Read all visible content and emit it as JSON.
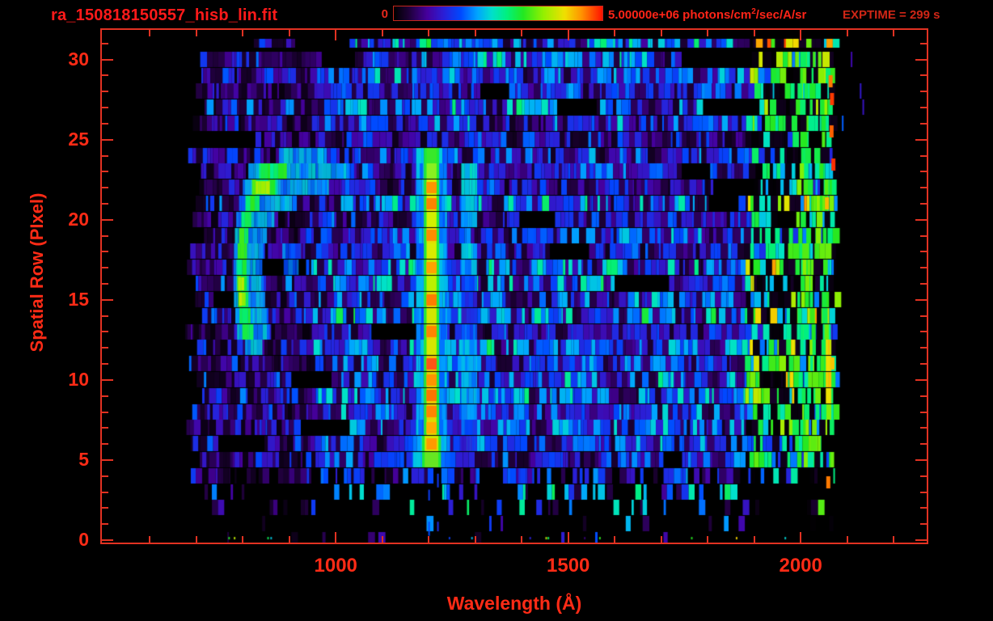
{
  "header": {
    "title": "ra_150818150557_hisb_lin.fit",
    "exptime": "EXPTIME = 299 s",
    "colorbar": {
      "min_label": "0",
      "max_prefix": "5.00000e+06 photons/cm",
      "max_sup": "2",
      "max_suffix": "/sec/A/sr"
    }
  },
  "chart_data": {
    "type": "heatmap",
    "title": "ra_150818150557_hisb_lin.fit",
    "xlabel": "Wavelength (Å)",
    "ylabel": "Spatial Row (PIxel)",
    "xlim": [
      497,
      2271
    ],
    "ylim": [
      -0.15,
      31.85
    ],
    "grid": false,
    "frame_color": "#e23222",
    "label_color": "#ff2b16",
    "xticks": [
      {
        "value": 1000,
        "label": "1000"
      },
      {
        "value": 1500,
        "label": "1500"
      },
      {
        "value": 2000,
        "label": "2000"
      }
    ],
    "xtick_minor": {
      "from": 600,
      "to": 2200,
      "step": 100
    },
    "yticks": [
      {
        "value": 0,
        "label": "0"
      },
      {
        "value": 5,
        "label": "5"
      },
      {
        "value": 10,
        "label": "10"
      },
      {
        "value": 15,
        "label": "15"
      },
      {
        "value": 20,
        "label": "20"
      },
      {
        "value": 25,
        "label": "25"
      },
      {
        "value": 30,
        "label": "30"
      }
    ],
    "ytick_minor": {
      "from": 0,
      "to": 31,
      "step": 1
    },
    "colorbar": {
      "min": 0,
      "max": 5000000,
      "units": "photons/cm2/sec/A/sr"
    },
    "exposure_seconds": 299,
    "colormap_stops": [
      [
        0.0,
        "#000000"
      ],
      [
        0.07,
        "#1e0038"
      ],
      [
        0.16,
        "#46009e"
      ],
      [
        0.24,
        "#2a20d8"
      ],
      [
        0.32,
        "#0048ff"
      ],
      [
        0.4,
        "#00a4ff"
      ],
      [
        0.47,
        "#00e0cc"
      ],
      [
        0.54,
        "#00f080"
      ],
      [
        0.62,
        "#22e822"
      ],
      [
        0.72,
        "#96f000"
      ],
      [
        0.82,
        "#f0e000"
      ],
      [
        0.9,
        "#ff9400"
      ],
      [
        1.0,
        "#ff1400"
      ]
    ],
    "noise": {
      "row_range": [
        0,
        31
      ],
      "data_wavelength": [
        675,
        2066
      ],
      "sparse_row_density": [
        0.05,
        0.07,
        0.15,
        0.32,
        0.6
      ],
      "regions": [
        {
          "until": 950,
          "weights": [
            [
              0.5,
              0.02,
              0.11
            ],
            [
              0.86,
              0.12,
              0.26
            ],
            [
              1.0,
              0.26,
              0.36
            ]
          ]
        },
        {
          "until": 1880,
          "weights": [
            [
              0.28,
              0.04,
              0.14
            ],
            [
              0.76,
              0.16,
              0.36
            ],
            [
              0.95,
              0.34,
              0.44
            ],
            [
              1.0,
              0.42,
              0.5
            ]
          ]
        },
        {
          "until": 2066,
          "weights": [
            [
              0.4,
              0.0,
              0.05
            ],
            [
              0.58,
              0.28,
              0.42
            ],
            [
              0.92,
              0.5,
              0.7
            ],
            [
              1.0,
              0.68,
              0.8
            ]
          ]
        }
      ]
    },
    "features": {
      "arc": {
        "label": "curved-emission-feature",
        "rows": [
          {
            "r": 24,
            "cyan": [
              878,
              970
            ]
          },
          {
            "r": 23,
            "green": [
              835,
              895
            ],
            "cyan": [
              812,
              1030
            ]
          },
          {
            "r": 22,
            "green": [
              820,
              872
            ],
            "cyan": [
              800,
              985
            ],
            "core2": [
              828,
              858
            ]
          },
          {
            "r": 21,
            "green": [
              806,
              836
            ],
            "cyan": [
              792,
              906
            ]
          },
          {
            "r": 20,
            "green": [
              797,
              818
            ],
            "cyan": [
              786,
              868
            ]
          },
          {
            "r": 19,
            "green": [
              792,
              812
            ],
            "cyan": [
              783,
              852
            ]
          },
          {
            "r": 18,
            "green": [
              789,
              809
            ],
            "cyan": [
              781,
              846
            ],
            "cyan2": [
              885,
              925
            ]
          },
          {
            "r": 17,
            "green": [
              788,
              808
            ],
            "cyan": [
              780,
              842
            ],
            "cyan2": [
              888,
              920
            ]
          },
          {
            "r": 16,
            "green": [
              788,
              809
            ],
            "cyan": [
              780,
              845
            ],
            "core2": [
              790,
              803
            ]
          },
          {
            "r": 15,
            "green": [
              790,
              812
            ],
            "cyan": [
              781,
              848
            ],
            "core2": [
              792,
              806
            ]
          },
          {
            "r": 14,
            "green": [
              793,
              817
            ],
            "cyan": [
              784,
              852
            ]
          },
          {
            "r": 13,
            "green": [
              799,
              823
            ],
            "cyan": [
              788,
              858
            ]
          },
          {
            "r": 12,
            "cyan": [
              805,
              842
            ]
          }
        ]
      },
      "main_line": {
        "label": "bright-emission-line",
        "center": 1206,
        "core_halfwidth": 16,
        "glow_halfwidth": 33,
        "rows": [
          [
            24,
            "#38e82a",
            null
          ],
          [
            23,
            "#8af020",
            null
          ],
          [
            22,
            "#d8ee00",
            "#ff9400"
          ],
          [
            21,
            "#e6e400",
            "#ff8400"
          ],
          [
            20,
            "#d2f000",
            null
          ],
          [
            19,
            "#e2de00",
            "#ff8c00"
          ],
          [
            18,
            "#d8ea00",
            null
          ],
          [
            17,
            "#cee800",
            "#ffa200"
          ],
          [
            16,
            "#bcf000",
            null
          ],
          [
            15,
            "#e2d600",
            "#ff7c00"
          ],
          [
            14,
            "#d2e600",
            null
          ],
          [
            13,
            "#e6d200",
            "#ff8400"
          ],
          [
            12,
            "#d8e600",
            null
          ],
          [
            11,
            "#eec600",
            "#ff5414"
          ],
          [
            10,
            "#e0d200",
            "#ff9400"
          ],
          [
            9,
            "#eecb00",
            "#ff7400"
          ],
          [
            8,
            "#e8cc00",
            "#ff8400"
          ],
          [
            7,
            "#e0d800",
            "#ffaa00"
          ],
          [
            6,
            "#cce600",
            "#ff9a00"
          ],
          [
            5,
            "#66e622",
            null
          ]
        ]
      },
      "secondary_line": {
        "label": "faint-emission-line",
        "center": 1287,
        "halfwidth": 17,
        "rows": [
          [
            23,
            0.46
          ],
          [
            22,
            0.44
          ],
          [
            21,
            0.42
          ],
          [
            20,
            0.4
          ],
          [
            19,
            0.42
          ],
          [
            18,
            0.44
          ],
          [
            17,
            0.4
          ],
          [
            16,
            0.3
          ],
          [
            15,
            0.28
          ],
          [
            14,
            0.26
          ],
          [
            13,
            0.34
          ],
          [
            12,
            0.4
          ],
          [
            11,
            0.42
          ],
          [
            10,
            0.4
          ],
          [
            9,
            0.42
          ],
          [
            8,
            0.38
          ],
          [
            7,
            0.32
          ],
          [
            6,
            0.26
          ]
        ]
      },
      "right_band": {
        "label": "long-wavelength-bright-band",
        "range": [
          1988,
          2066
        ],
        "row_range": [
          5,
          30
        ],
        "yellow_rows": [
          9,
          12
        ],
        "yellow_range": [
          2054,
          2066
        ]
      },
      "specks": [
        [
          28.6,
          2060,
          0.92
        ],
        [
          27.5,
          2063,
          0.97
        ],
        [
          25.5,
          2062,
          0.94
        ],
        [
          23.4,
          2066,
          0.98
        ],
        [
          21.0,
          2052,
          0.86
        ],
        [
          3.6,
          2055,
          0.92
        ],
        [
          11.0,
          2064,
          0.85
        ]
      ],
      "remnant_columns": {
        "wavelengths": [
          1199,
          1218,
          1287
        ],
        "row_range": [
          0,
          4.5
        ]
      }
    }
  }
}
